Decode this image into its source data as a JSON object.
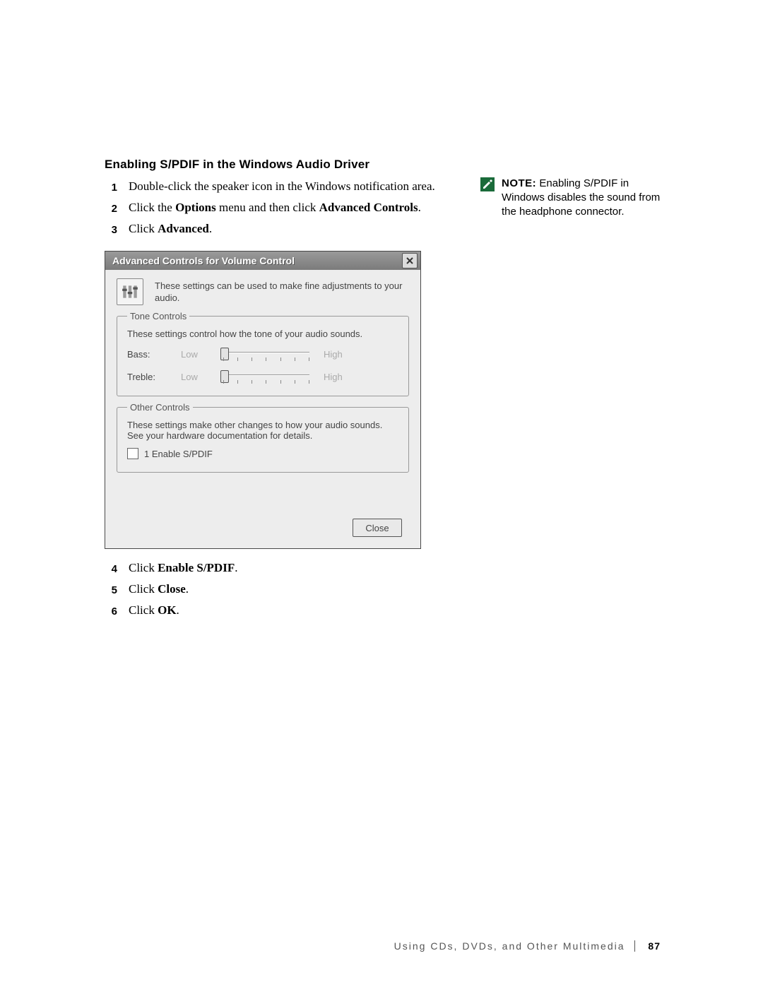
{
  "heading": "Enabling S/PDIF in the Windows Audio Driver",
  "steps_top": [
    {
      "n": "1",
      "text": "Double-click the speaker icon in the Windows notification area.",
      "bolds": []
    },
    {
      "n": "2",
      "text": "Click the Options menu and then click Advanced Controls.",
      "bolds": [
        "Options",
        "Advanced Controls"
      ]
    },
    {
      "n": "3",
      "text": "Click Advanced.",
      "bolds": [
        "Advanced"
      ]
    }
  ],
  "steps_bottom": [
    {
      "n": "4",
      "text": "Click Enable S/PDIF.",
      "bolds": [
        "Enable S/PDIF"
      ]
    },
    {
      "n": "5",
      "text": "Click Close.",
      "bolds": [
        "Close"
      ]
    },
    {
      "n": "6",
      "text": "Click OK.",
      "bolds": [
        "OK"
      ]
    }
  ],
  "note": {
    "label": "NOTE:",
    "text": "Enabling S/PDIF in Windows disables the sound from the headphone connector."
  },
  "dialog": {
    "title": "Advanced Controls for Volume Control",
    "intro": "These settings can be used to make fine adjustments to your audio.",
    "tone": {
      "legend": "Tone Controls",
      "desc": "These settings control how the tone of your audio sounds.",
      "rows": [
        {
          "label": "Bass:",
          "low": "Low",
          "high": "High"
        },
        {
          "label": "Treble:",
          "low": "Low",
          "high": "High"
        }
      ]
    },
    "other": {
      "legend": "Other Controls",
      "desc": "These settings make other changes to how your audio sounds.  See your hardware documentation for details.",
      "check_label": "1  Enable S/PDIF"
    },
    "close_btn": "Close"
  },
  "footer": {
    "text": "Using CDs, DVDs, and Other Multimedia",
    "page": "87"
  }
}
